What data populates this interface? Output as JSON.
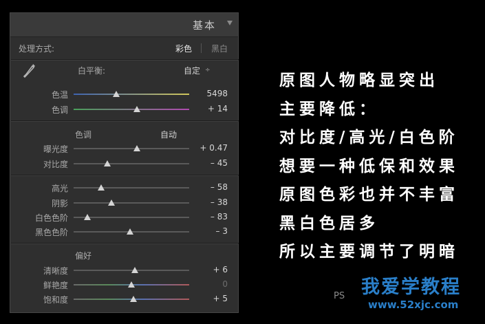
{
  "panel": {
    "title": "基本",
    "treatment": {
      "label": "处理方式:",
      "color": "彩色",
      "bw": "黑白"
    },
    "wb": {
      "label": "白平衡:",
      "value": "自定",
      "arrow": "÷"
    },
    "sliders": {
      "temp": {
        "label": "色温",
        "value": "5498",
        "pos": 0.37
      },
      "tint": {
        "label": "色调",
        "value": "+ 14",
        "pos": 0.55
      },
      "exposure": {
        "label": "曝光度",
        "value": "+ 0.47",
        "pos": 0.55
      },
      "contrast": {
        "label": "对比度",
        "value": "– 45",
        "pos": 0.29
      },
      "highlights": {
        "label": "高光",
        "value": "– 58",
        "pos": 0.24
      },
      "shadows": {
        "label": "阴影",
        "value": "– 38",
        "pos": 0.33
      },
      "whites": {
        "label": "白色色阶",
        "value": "– 83",
        "pos": 0.12
      },
      "blacks": {
        "label": "黑色色阶",
        "value": "– 3",
        "pos": 0.49
      },
      "clarity": {
        "label": "清晰度",
        "value": "+ 6",
        "pos": 0.53
      },
      "vibrance": {
        "label": "鲜艳度",
        "value": "0",
        "pos": 0.5
      },
      "saturation": {
        "label": "饱和度",
        "value": "+ 5",
        "pos": 0.52
      }
    },
    "tone": {
      "label": "色调",
      "auto": "自动"
    },
    "presence": {
      "label": "偏好"
    }
  },
  "notes": {
    "lines": [
      "原图人物略显突出",
      "主要降低：",
      "对比度/高光/白色阶",
      "想要一种低保和效果",
      "原图色彩也并不丰富",
      "黑白色居多",
      "所以主要调节了明暗"
    ]
  },
  "watermark": {
    "title": "我爱学教程",
    "url": "www.52xjc.com",
    "ps": "PS"
  },
  "colors": {
    "accent": "#2a7fc9",
    "panel_bg": "#2f2f2f"
  }
}
